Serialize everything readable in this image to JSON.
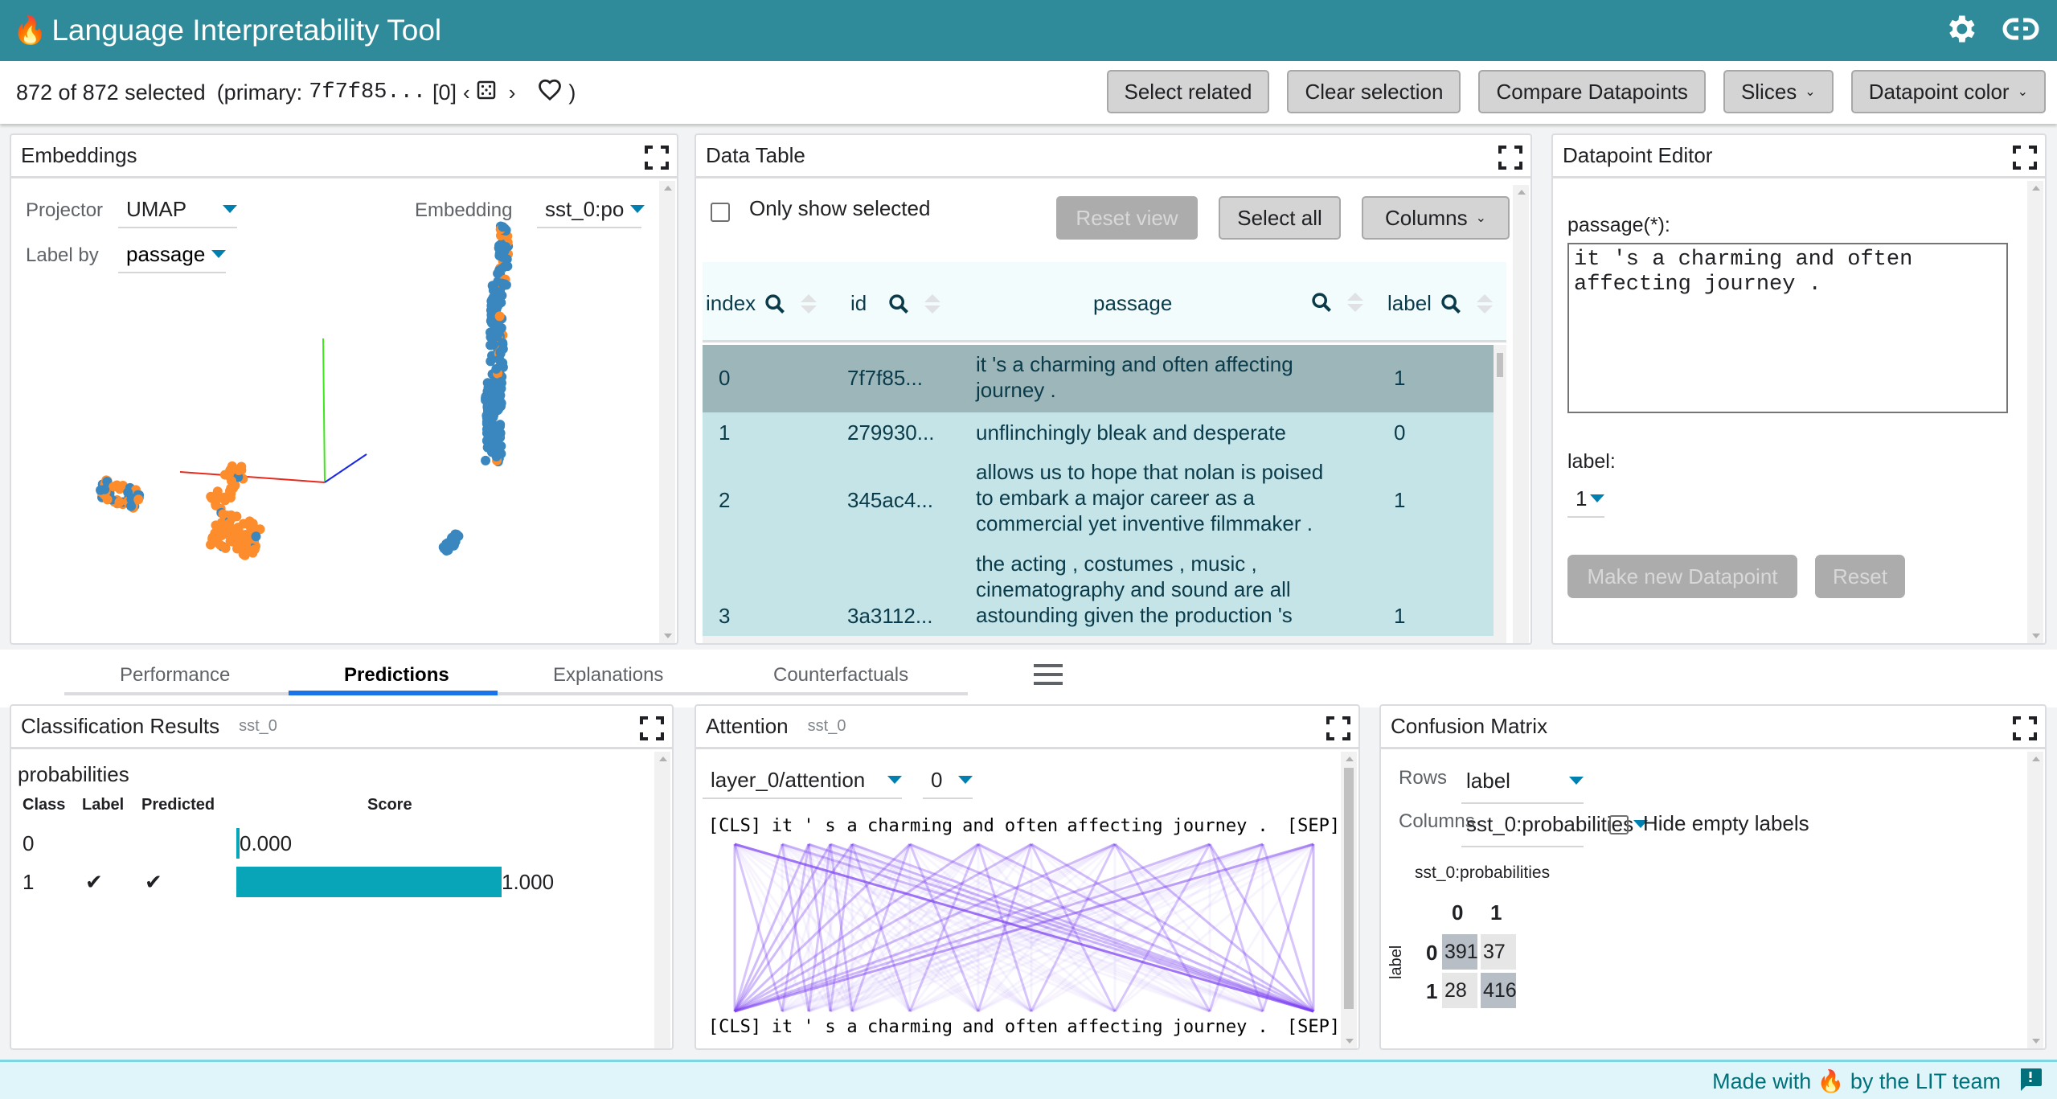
{
  "app": {
    "title": "Language Interpretability Tool",
    "logo_icon": "flame-icon",
    "header_icons": [
      "gear-icon",
      "link-icon"
    ]
  },
  "selection": {
    "count_text": "872 of 872 selected",
    "primary_prefix": "(primary:",
    "primary_id": "7f7f85...",
    "primary_index": "[0]",
    "prev_icon": "chevron-left-icon",
    "random_icon": "dice-icon",
    "next_icon": "chevron-right-icon",
    "favorite_icon": "heart-outline-icon",
    "close_paren": ")",
    "buttons": {
      "select_related": "Select related",
      "clear_selection": "Clear selection",
      "compare_datapoints": "Compare Datapoints",
      "slices": "Slices",
      "datapoint_color": "Datapoint color"
    }
  },
  "embeddings": {
    "title": "Embeddings",
    "projector_label": "Projector",
    "projector_value": "UMAP",
    "embedding_label": "Embedding",
    "embedding_value": "sst_0:po",
    "label_by_label": "Label by",
    "label_by_value": "passage",
    "point_colors": {
      "class_0": "#3a87bf",
      "class_1": "#fd8d2c"
    },
    "axis_colors": {
      "x": "#e8291b",
      "y": "#3fe81b",
      "z": "#1b28e8"
    }
  },
  "data_table": {
    "title": "Data Table",
    "only_show_selected": "Only show selected",
    "reset_view": "Reset view",
    "select_all": "Select all",
    "columns_button": "Columns",
    "headers": [
      "index",
      "id",
      "passage",
      "label"
    ],
    "rows": [
      {
        "index": "0",
        "id": "7f7f85...",
        "passage": "it 's a charming and often affecting journey .",
        "label": "1"
      },
      {
        "index": "1",
        "id": "279930...",
        "passage": "unflinchingly bleak and desperate",
        "label": "0"
      },
      {
        "index": "2",
        "id": "345ac4...",
        "passage": "allows us to hope that nolan is poised to embark a major career as a commercial yet inventive filmmaker .",
        "label": "1"
      },
      {
        "index": "3",
        "id": "3a3112...",
        "passage": "the acting , costumes , music , cinematography and sound are all astounding given the production 's",
        "label": "1"
      }
    ]
  },
  "datapoint_editor": {
    "title": "Datapoint Editor",
    "passage_label": "passage(*):",
    "passage_value": "it 's a charming and often affecting journey .",
    "label_label": "label:",
    "label_value": "1",
    "make_new": "Make new Datapoint",
    "reset": "Reset"
  },
  "tabs": {
    "items": [
      "Performance",
      "Predictions",
      "Explanations",
      "Counterfactuals"
    ],
    "active": "Predictions",
    "menu_icon": "hamburger-menu-icon"
  },
  "classification": {
    "title": "Classification Results",
    "model": "sst_0",
    "section": "probabilities",
    "headers": [
      "Class",
      "Label",
      "Predicted",
      "Score"
    ],
    "rows": [
      {
        "class": "0",
        "label": "",
        "predicted": "",
        "score": 0.0,
        "score_text": "0.000"
      },
      {
        "class": "1",
        "label": "✔",
        "predicted": "✔",
        "score": 1.0,
        "score_text": "1.000"
      }
    ],
    "bar_color": "#08a4b8"
  },
  "attention": {
    "title": "Attention",
    "model": "sst_0",
    "layer_value": "layer_0/attention",
    "head_value": "0",
    "tokens": [
      "[CLS]",
      "it",
      "'",
      "s",
      "a",
      "charming",
      "and",
      "often",
      "affecting",
      "journey",
      ".",
      "[SEP]"
    ],
    "line_color": "#7b3ff2"
  },
  "confusion": {
    "title": "Confusion Matrix",
    "rows_label": "Rows",
    "rows_value": "label",
    "columns_label": "Columns",
    "columns_value": "sst_0:probabilities",
    "hide_empty": "Hide empty labels",
    "col_title": "sst_0:probabilities",
    "row_title": "label",
    "col_labels": [
      "0",
      "1"
    ],
    "row_labels": [
      "0",
      "1"
    ],
    "matrix": [
      [
        391,
        37
      ],
      [
        28,
        416
      ]
    ]
  },
  "footer": {
    "prefix": "Made with",
    "suffix": "by the LIT team",
    "flame_icon": "flame-icon",
    "feedback_icon": "feedback-icon"
  }
}
